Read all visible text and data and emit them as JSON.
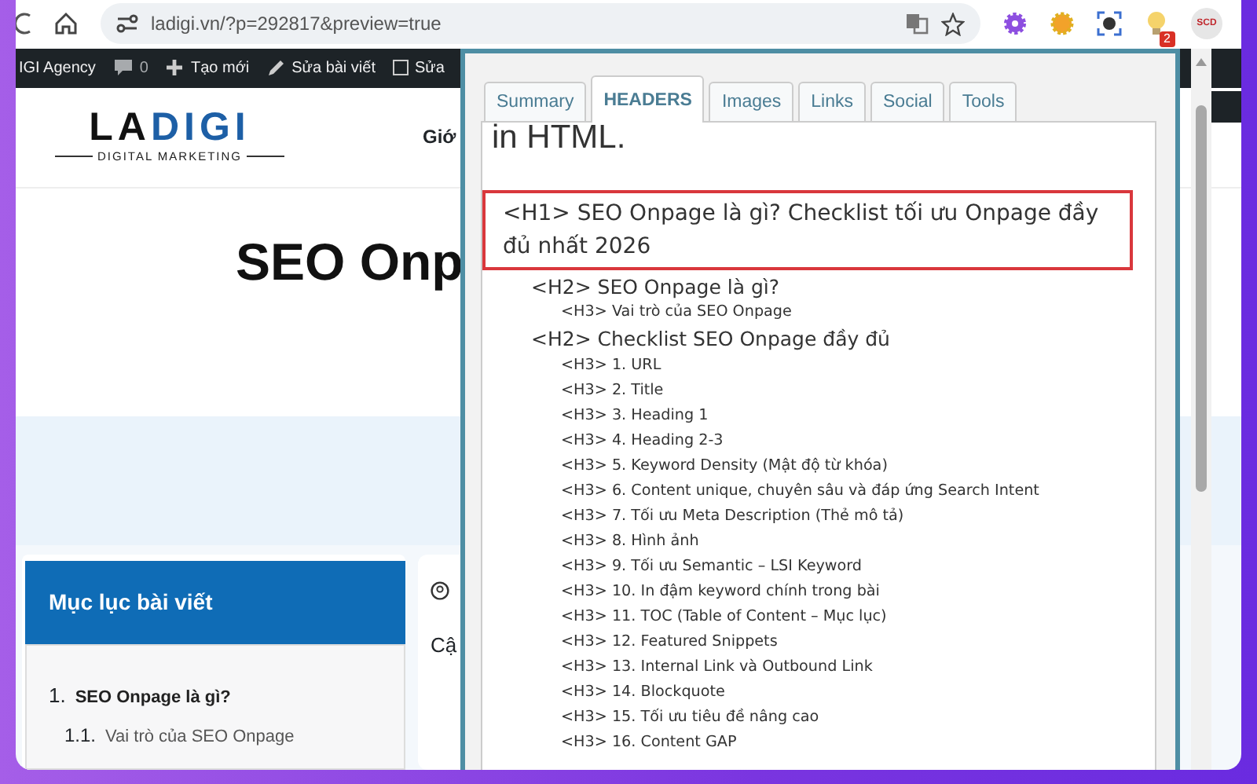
{
  "browser": {
    "url": "ladigi.vn/?p=292817&preview=true",
    "extension_badge": "2",
    "extension_label": "SCD"
  },
  "admin_bar": {
    "site": "IGI Agency",
    "comments": "0",
    "new": "Tạo mới",
    "edit": "Sửa bài viết",
    "edit2": "Sửa"
  },
  "site": {
    "logo": [
      {
        "text": "LA",
        "color": "#111111"
      },
      {
        "text": "DIGI",
        "color": "#1d5fa6"
      }
    ],
    "tagline": "DIGITAL MARKETING",
    "nav": "Giớ",
    "title_left": "SEO Onp",
    "toc": {
      "title": "Mục lục bài viết",
      "items": [
        {
          "number": "1.",
          "text": "SEO Onpage là gì?",
          "children": [
            {
              "number": "1.1.",
              "text": "Vai trò của SEO Onpage"
            }
          ]
        }
      ]
    },
    "meta_text": "Cậ"
  },
  "panel": {
    "tabs": [
      {
        "label": "Summary",
        "selected": false
      },
      {
        "label": "HEADERS",
        "selected": true
      },
      {
        "label": "Images",
        "selected": false
      },
      {
        "label": "Links",
        "selected": false
      },
      {
        "label": "Social",
        "selected": false
      },
      {
        "label": "Tools",
        "selected": false
      }
    ],
    "intro": "in HTML.",
    "headers": [
      {
        "text": "<H1> SEO Onpage là gì? Checklist tối ưu Onpage đầy đủ nhất 2026",
        "highlighted": true,
        "children": [
          {
            "text": "<H2> SEO Onpage là gì?",
            "children": [
              {
                "text": "<H3> Vai trò của SEO Onpage"
              }
            ]
          },
          {
            "text": "<H2> Checklist SEO Onpage đầy đủ",
            "children": [
              {
                "text": "<H3> 1. URL"
              },
              {
                "text": "<H3> 2. Title"
              },
              {
                "text": "<H3> 3. Heading 1"
              },
              {
                "text": "<H3> 4. Heading 2-3"
              },
              {
                "text": "<H3> 5. Keyword Density (Mật độ từ khóa)"
              },
              {
                "text": "<H3> 6. Content unique, chuyên sâu và đáp ứng Search Intent"
              },
              {
                "text": "<H3> 7. Tối ưu Meta Description (Thẻ mô tả)"
              },
              {
                "text": "<H3> 8. Hình ảnh"
              },
              {
                "text": "<H3> 9. Tối ưu Semantic – LSI Keyword"
              },
              {
                "text": "<H3> 10. In đậm keyword chính trong bài"
              },
              {
                "text": "<H3> 11. TOC (Table of Content – Mục lục)"
              },
              {
                "text": "<H3> 12. Featured Snippets"
              },
              {
                "text": "<H3> 13. Internal Link và Outbound Link"
              },
              {
                "text": "<H3> 14. Blockquote"
              },
              {
                "text": "<H3> 15. Tối ưu tiêu đề nâng cao"
              },
              {
                "text": "<H3> 16. Content GAP"
              }
            ]
          }
        ]
      }
    ]
  }
}
